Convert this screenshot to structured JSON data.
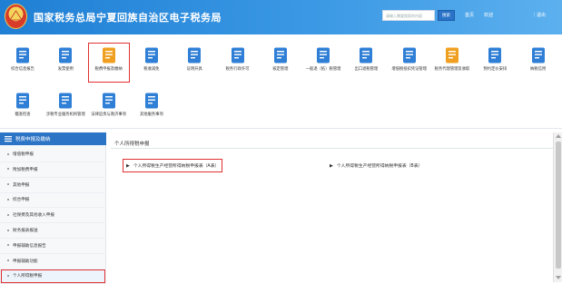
{
  "header": {
    "title": "国家税务总局宁夏回族自治区电子税务局",
    "search_placeholder": "请输入需要搜索的内容",
    "search_button": "搜索",
    "links": [
      "首页",
      "欢迎",
      "｜退出"
    ]
  },
  "toolbar": {
    "row1": [
      {
        "label": "综合信息报告",
        "icon": "document-icon",
        "color": "#2f7fd6"
      },
      {
        "label": "发票使用",
        "icon": "invoice-icon",
        "color": "#2f7fd6"
      },
      {
        "label": "税费申报及缴纳",
        "icon": "tax-declaration-icon",
        "color": "#f0a020",
        "selected": true
      },
      {
        "label": "税收减免",
        "icon": "tax-reduction-icon",
        "color": "#2f7fd6"
      },
      {
        "label": "证明开具",
        "icon": "certificate-icon",
        "color": "#2f7fd6"
      },
      {
        "label": "税务行政许可",
        "icon": "permit-icon",
        "color": "#2f7fd6"
      },
      {
        "label": "核定管理",
        "icon": "assessment-icon",
        "color": "#2f7fd6"
      },
      {
        "label": "一般退（抵）税管理",
        "icon": "refund-icon",
        "color": "#2f7fd6"
      },
      {
        "label": "出口退税管理",
        "icon": "export-refund-icon",
        "color": "#2f7fd6"
      },
      {
        "label": "增值税抵扣凭证管理",
        "icon": "vat-voucher-icon",
        "color": "#2f7fd6"
      },
      {
        "label": "税务代理管理及收取",
        "icon": "agency-icon",
        "color": "#f0a020"
      },
      {
        "label": "预约定价安排",
        "icon": "pricing-icon",
        "color": "#2f7fd6"
      },
      {
        "label": "纳税信用",
        "icon": "credit-icon",
        "color": "#2f7fd6"
      }
    ],
    "row2": [
      {
        "label": "稽查检查",
        "icon": "inspection-icon",
        "color": "#2f7fd6"
      },
      {
        "label": "涉税专业服务机构管理",
        "icon": "agency-org-icon",
        "color": "#2f7fd6"
      },
      {
        "label": "法律追责与救济事项",
        "icon": "legal-icon",
        "color": "#2f7fd6"
      },
      {
        "label": "其他服务事项",
        "icon": "handshake-icon",
        "color": "#2f7fd6"
      }
    ]
  },
  "sidebar": {
    "header": "税费申报及缴纳",
    "items": [
      {
        "label": "增值税申报"
      },
      {
        "label": "附加税费申报"
      },
      {
        "label": "其他申报"
      },
      {
        "label": "综合申报"
      },
      {
        "label": "社保费及其他收入申报"
      },
      {
        "label": "财务报表报送"
      },
      {
        "label": "申报辅助信息报告"
      },
      {
        "label": "申报辅助功能"
      },
      {
        "label": "个人所得税申报",
        "selected": true
      }
    ]
  },
  "content": {
    "title": "个人所得税申报",
    "forms": [
      {
        "label": "个人所得税生产经营所得纳税申报表（A表）",
        "selected": true
      },
      {
        "label": "个人所得税生产经营所得纳税申报表（B表）"
      }
    ]
  }
}
